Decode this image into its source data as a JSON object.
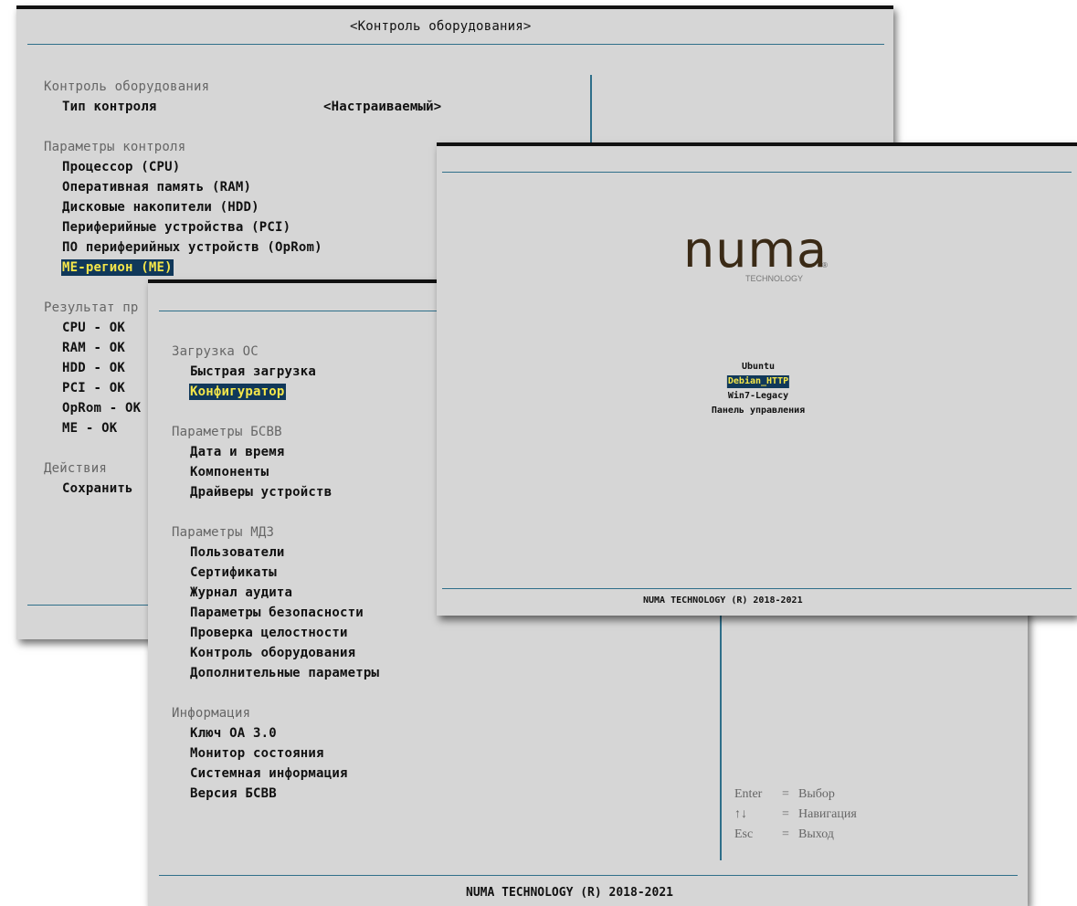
{
  "window1": {
    "title": "<Контроль оборудования>",
    "section1": "Контроль оборудования",
    "control_type_label": "Тип контроля",
    "control_type_value": "<Настраиваемый>",
    "section2": "Параметры контроля",
    "params": [
      "Процессор (CPU)",
      "Оперативная память (RAM)",
      "Дисковые накопители (HDD)",
      "Периферийные устройства (PCI)",
      "ПО периферийных устройств (OpRom)",
      "ME-регион (ME)"
    ],
    "section3": "Результат пр",
    "results": [
      "CPU - OK",
      "RAM - OK",
      "HDD - OK",
      "PCI - OK",
      "OpRom - OK",
      "ME - OK"
    ],
    "section4": "Действия",
    "action": "Сохранить"
  },
  "window2": {
    "section_boot": "Загрузка ОС",
    "boot_items": [
      "Быстрая загрузка",
      "Конфигуратор"
    ],
    "section_bios": "Параметры БСВВ",
    "bios_items": [
      "Дата и время",
      "Компоненты",
      "Драйверы устройств"
    ],
    "section_mdz": "Параметры МДЗ",
    "mdz_items": [
      "Пользователи",
      "Сертификаты",
      "Журнал аудита",
      "Параметры безопасности",
      "Проверка целостности",
      "Контроль оборудования",
      "Дополнительные параметры"
    ],
    "section_info": "Информация",
    "info_items": [
      "Ключ ОА 3.0",
      "Монитор состояния",
      "Системная информация",
      "Версия БСВВ"
    ],
    "help": [
      {
        "key": "Enter",
        "eq": "=",
        "desc": "Выбор"
      },
      {
        "key": "↑↓",
        "eq": "=",
        "desc": "Навигация"
      },
      {
        "key": "Esc",
        "eq": "=",
        "desc": "Выход"
      }
    ],
    "footer": "NUMA TECHNOLOGY (R) 2018-2021"
  },
  "window3": {
    "logo_text": "numa",
    "logo_sub": "TECHNOLOGY",
    "logo_mark": "®",
    "boot_options": [
      "Ubuntu",
      "Debian_HTTP",
      "Win7-Legacy",
      "Панель управления"
    ],
    "footer": "NUMA TECHNOLOGY (R) 2018-2021"
  }
}
